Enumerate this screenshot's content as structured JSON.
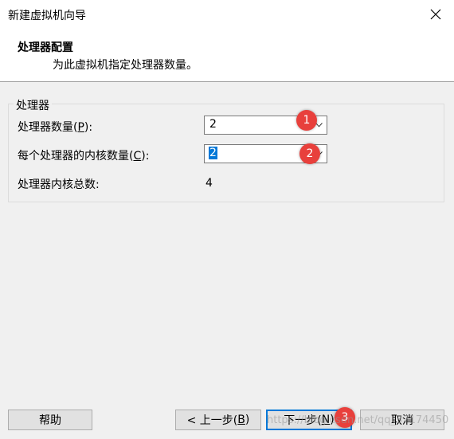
{
  "window": {
    "title": "新建虚拟机向导"
  },
  "header": {
    "title": "处理器配置",
    "subtitle": "为此虚拟机指定处理器数量。"
  },
  "group": {
    "label": "处理器"
  },
  "processor_count": {
    "label_prefix": "处理器数量(",
    "accel": "P",
    "label_suffix": "):",
    "value": "2"
  },
  "cores_per_processor": {
    "label_prefix": "每个处理器的内核数量(",
    "accel": "C",
    "label_suffix": "):",
    "value": "2"
  },
  "total_cores": {
    "label": "处理器内核总数:",
    "value": "4"
  },
  "badges": [
    "1",
    "2",
    "3"
  ],
  "buttons": {
    "help": "帮助",
    "back_prefix": "< 上一步(",
    "back_accel": "B",
    "back_suffix": ")",
    "next_prefix": "下一步(",
    "next_accel": "N",
    "next_suffix": ")",
    "cancel": "取消"
  },
  "watermark": "https://blog.csdn.net/qq_37174450",
  "colors": {
    "badge": "#e8403c",
    "selection": "#0078d7",
    "focus": "#0078d7"
  }
}
